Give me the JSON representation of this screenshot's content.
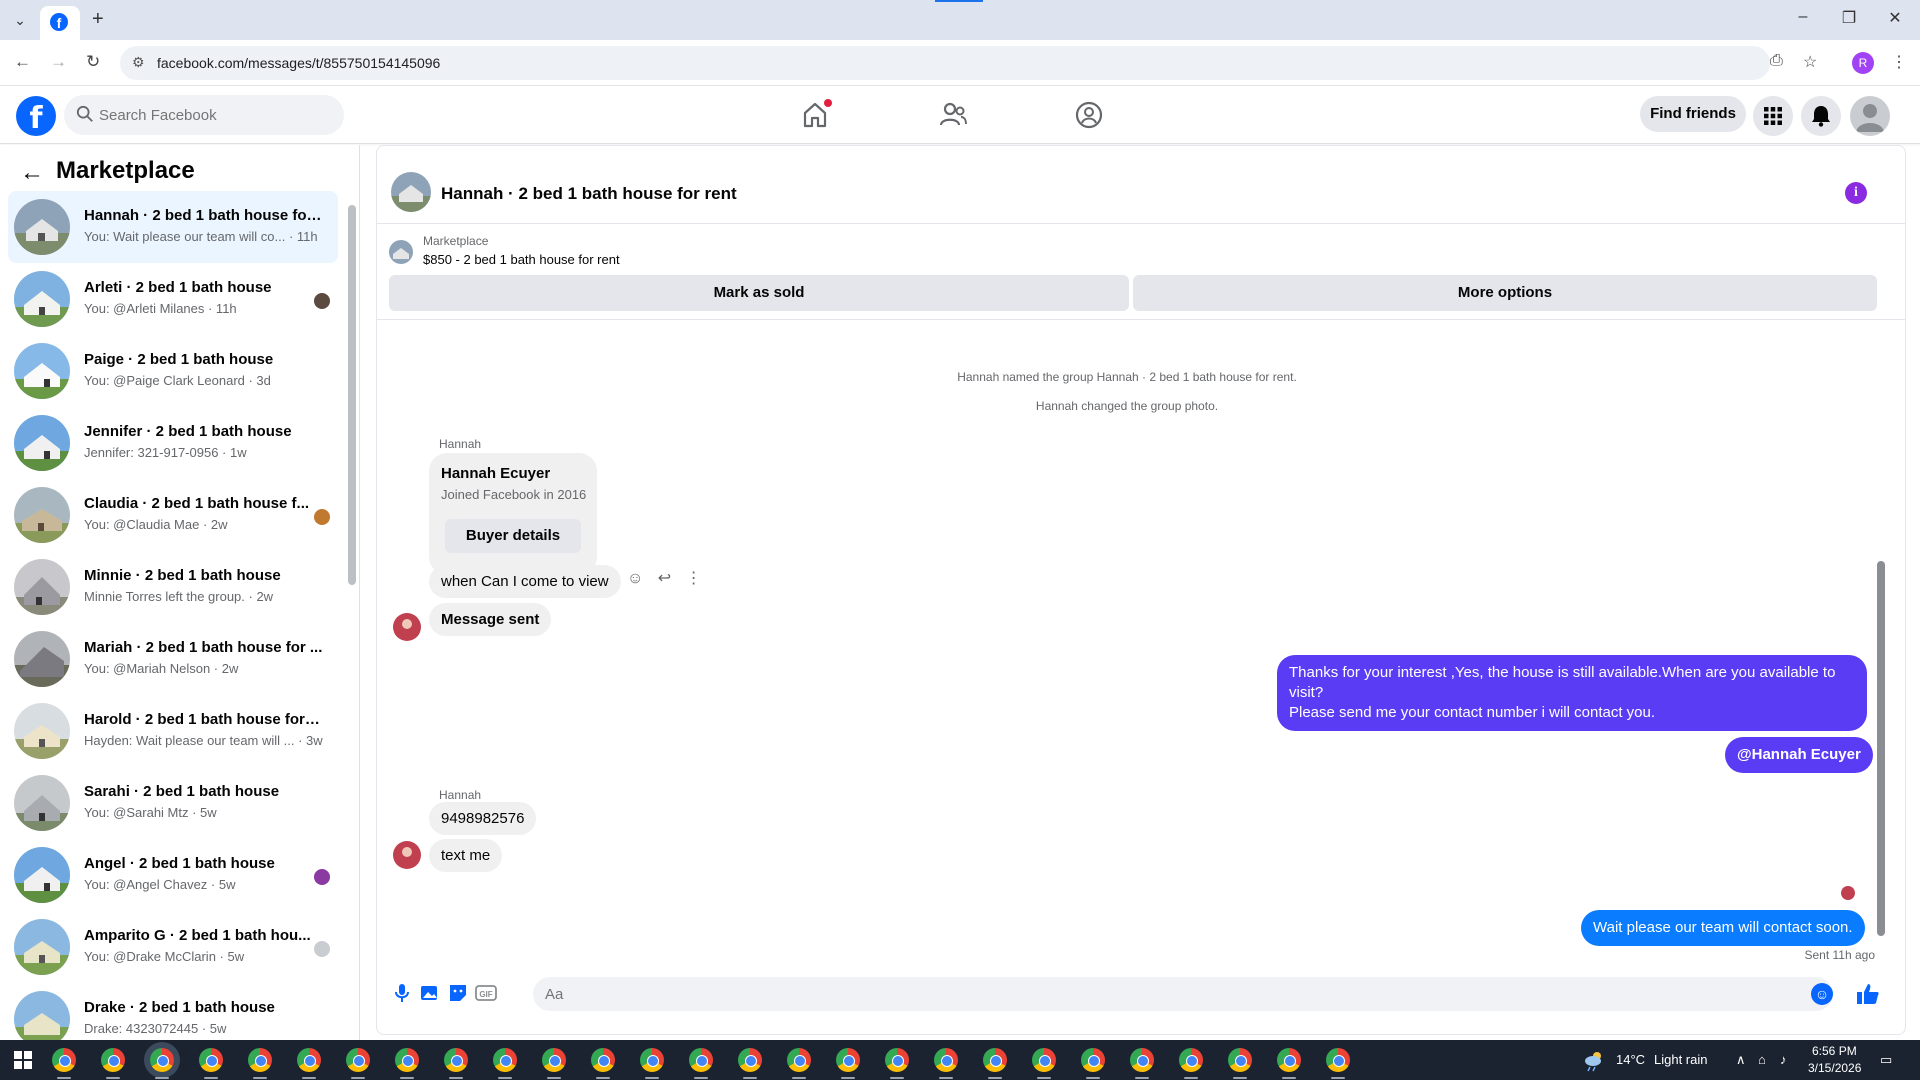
{
  "browser": {
    "url": "facebook.com/messages/t/855750154145096",
    "profile_initial": "R"
  },
  "fb_header": {
    "search_placeholder": "Search Facebook",
    "find_friends": "Find friends"
  },
  "sidebar": {
    "title": "Marketplace",
    "conversations": [
      {
        "title": "Hannah · 2 bed 1 bath house for...",
        "preview": "You: Wait please our team will co... · 11h",
        "active": true
      },
      {
        "title": "Arleti · 2 bed 1 bath house",
        "preview": "You: @Arleti Milanes · 11h"
      },
      {
        "title": "Paige · 2 bed 1 bath house",
        "preview": "You: @Paige Clark Leonard · 3d"
      },
      {
        "title": "Jennifer · 2 bed 1 bath house",
        "preview": "Jennifer: 321-917-0956 · 1w"
      },
      {
        "title": "Claudia · 2 bed 1 bath house f...",
        "preview": "You: @Claudia Mae · 2w"
      },
      {
        "title": "Minnie · 2 bed 1 bath house",
        "preview": "Minnie Torres left the group. · 2w"
      },
      {
        "title": "Mariah · 2 bed 1 bath house for ...",
        "preview": "You: @Mariah Nelson · 2w"
      },
      {
        "title": "Harold · 2 bed 1 bath house for r...",
        "preview": "Hayden: Wait please our team will ... · 3w"
      },
      {
        "title": "Sarahi · 2 bed 1 bath house",
        "preview": "You: @Sarahi Mtz · 5w"
      },
      {
        "title": "Angel · 2 bed 1 bath house",
        "preview": "You: @Angel Chavez · 5w"
      },
      {
        "title": "Amparito G · 2 bed 1 bath hou...",
        "preview": "You: @Drake McClarin · 5w"
      },
      {
        "title": "Drake · 2 bed 1 bath house",
        "preview": "Drake: 4323072445 · 5w"
      }
    ]
  },
  "chat": {
    "title": "Hannah · 2 bed 1 bath house for rent",
    "listing_category": "Marketplace",
    "listing_price": "$850 - 2 bed 1 bath house for rent",
    "mark_sold": "Mark as sold",
    "more_options": "More options",
    "system_1": "Hannah named the group Hannah · 2 bed 1 bath house for rent.",
    "system_2": "Hannah changed the group photo.",
    "sender_1": "Hannah",
    "card_name": "Hannah Ecuyer",
    "card_sub": "Joined Facebook in 2016",
    "card_button": "Buyer details",
    "msg_1": "when Can I come to view",
    "msg_2": "Message sent",
    "out_1a": "Thanks for your interest ,Yes, the house is still available.When are you available to visit?",
    "out_1b": "Please send me your contact number i will contact you.",
    "out_2": "@Hannah Ecuyer",
    "sender_2": "Hannah",
    "msg_3": "9498982576",
    "msg_4": "text me",
    "out_3": "Wait please our team will contact soon.",
    "sent_status": "Sent 11h ago",
    "composer_placeholder": "Aa"
  },
  "taskbar": {
    "temperature": "14°C",
    "weather": "Light rain",
    "time": "6:56 PM",
    "date": "3/15/2026"
  }
}
